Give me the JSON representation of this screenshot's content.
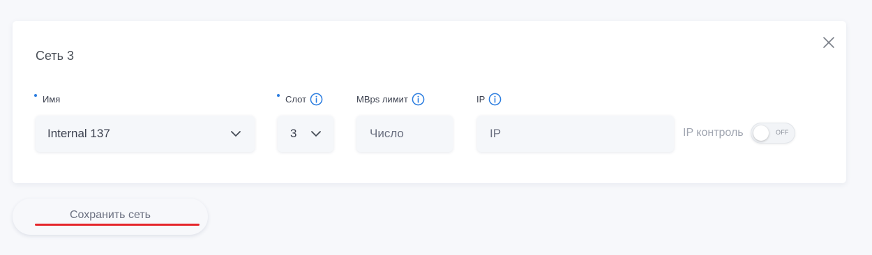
{
  "card": {
    "title": "Сеть 3"
  },
  "fields": {
    "name": {
      "label": "Имя",
      "required": true,
      "value": "Internal 137"
    },
    "slot": {
      "label": "Слот",
      "required": true,
      "value": "3"
    },
    "mbps_limit": {
      "label": "MBps лимит",
      "placeholder": "Число"
    },
    "ip": {
      "label": "IP",
      "placeholder": "IP"
    }
  },
  "ip_control": {
    "label": "IP контроль",
    "toggle_text": "OFF",
    "enabled": false
  },
  "actions": {
    "save_label": "Сохранить сеть"
  },
  "colors": {
    "accent": "#2b7de0",
    "underline": "#e5252a"
  },
  "icons": {
    "close": "close-icon",
    "info": "info-icon",
    "chevron": "chevron-down-icon"
  }
}
